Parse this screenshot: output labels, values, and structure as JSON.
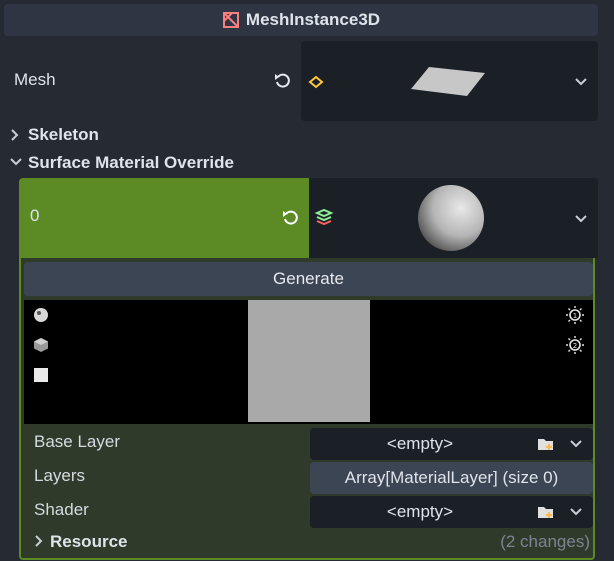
{
  "header": {
    "title": "MeshInstance3D",
    "icon": "mesh-instance-node-icon",
    "icon_color": "#fc7f7f"
  },
  "mesh": {
    "label": "Mesh",
    "revert_icon": "revert-icon",
    "resource_type_icon": "mesh-icon",
    "preview": "plane-mesh-preview"
  },
  "sections": {
    "skeleton": "Skeleton",
    "surface_override": "Surface Material Override"
  },
  "surface_slot": {
    "label": "0",
    "revert_icon": "revert-icon",
    "resource_type_icon": "material-layers-icon",
    "preview": "sphere-preview",
    "accent": "#5c8a25"
  },
  "material": {
    "generate_label": "Generate",
    "base_layer": {
      "label": "Base Layer",
      "value": "<empty>"
    },
    "layers": {
      "label": "Layers",
      "value": "Array[MaterialLayer] (size 0)"
    },
    "shader": {
      "label": "Shader",
      "value": "<empty>"
    },
    "resource": {
      "label": "Resource",
      "changes": "(2 changes)"
    }
  },
  "preview_icons": [
    "sphere-shape-icon",
    "cube-shape-icon",
    "quad-shape-icon",
    "light1-toggle-icon",
    "light2-toggle-icon"
  ]
}
